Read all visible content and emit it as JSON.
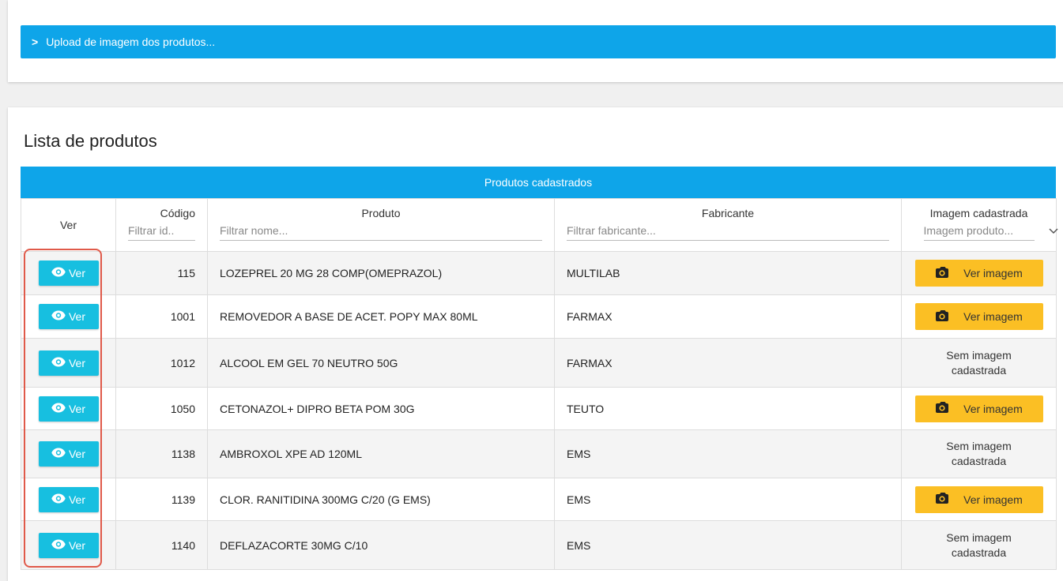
{
  "upload": {
    "chevron": ">",
    "label": "Upload de imagem dos produtos..."
  },
  "list": {
    "title": "Lista de produtos",
    "banner": "Produtos cadastrados",
    "columns": {
      "ver": "Ver",
      "codigo": "Código",
      "codigo_placeholder": "Filtrar id..",
      "produto": "Produto",
      "produto_placeholder": "Filtrar nome...",
      "fabricante": "Fabricante",
      "fabricante_placeholder": "Filtrar fabricante...",
      "imagem": "Imagem cadastrada",
      "imagem_select": "Imagem produto..."
    },
    "ver_button_label": "Ver",
    "ver_imagem_label": "Ver imagem",
    "sem_imagem_label": "Sem imagem cadastrada",
    "rows": [
      {
        "codigo": "115",
        "produto": "LOZEPREL 20 MG 28 COMP(OMEPRAZOL)",
        "fabricante": "MULTILAB",
        "has_image": true
      },
      {
        "codigo": "1001",
        "produto": "REMOVEDOR A BASE DE ACET. POPY MAX 80ML",
        "fabricante": "FARMAX",
        "has_image": true
      },
      {
        "codigo": "1012",
        "produto": "ALCOOL EM GEL 70 NEUTRO 50G",
        "fabricante": "FARMAX",
        "has_image": false
      },
      {
        "codigo": "1050",
        "produto": "CETONAZOL+ DIPRO BETA POM 30G",
        "fabricante": "TEUTO",
        "has_image": true
      },
      {
        "codigo": "1138",
        "produto": "AMBROXOL XPE AD 120ML",
        "fabricante": "EMS",
        "has_image": false
      },
      {
        "codigo": "1139",
        "produto": "CLOR. RANITIDINA 300MG C/20 (G EMS)",
        "fabricante": "EMS",
        "has_image": true
      },
      {
        "codigo": "1140",
        "produto": "DEFLAZACORTE 30MG C/10",
        "fabricante": "EMS",
        "has_image": false
      }
    ]
  },
  "colors": {
    "primary": "#0ea5e9",
    "ver_button": "#17bfe0",
    "image_button": "#fbbf24",
    "highlight": "#e05a4a"
  },
  "icons": {
    "upload_chevron": "chevron-right-icon",
    "ver": "eye-icon",
    "image": "camera-icon",
    "select_caret": "chevron-down-icon"
  }
}
